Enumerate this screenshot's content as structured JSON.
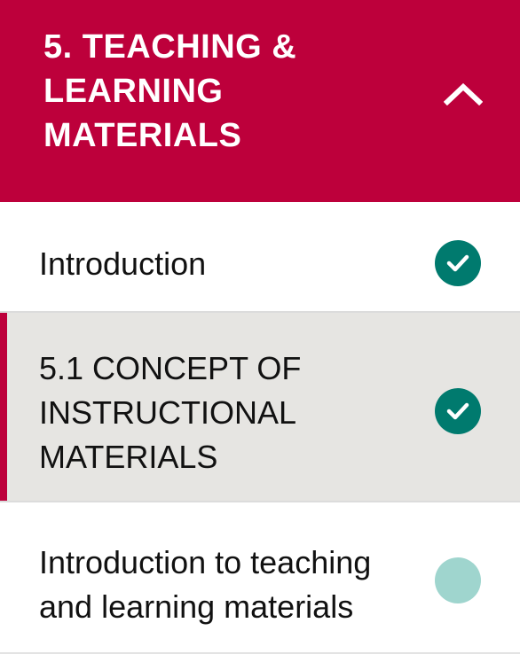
{
  "section": {
    "title": "5. Teaching & Learning Materials",
    "toggle_icon": "chevron-up-icon",
    "accent_color": "#bd003b"
  },
  "items": [
    {
      "label": "Introduction",
      "status": "complete",
      "status_icon": "check-circle-icon"
    },
    {
      "label": "5.1 Concept of Instructional Materials",
      "status": "complete",
      "status_icon": "check-circle-icon",
      "active": true
    },
    {
      "label": "Introduction to teaching and learning materials",
      "status": "not-started",
      "status_icon": "empty-circle-icon"
    }
  ],
  "colors": {
    "complete": "#007a6e",
    "incomplete": "#9fd5ce",
    "active_row_bg": "#e6e5e2"
  }
}
